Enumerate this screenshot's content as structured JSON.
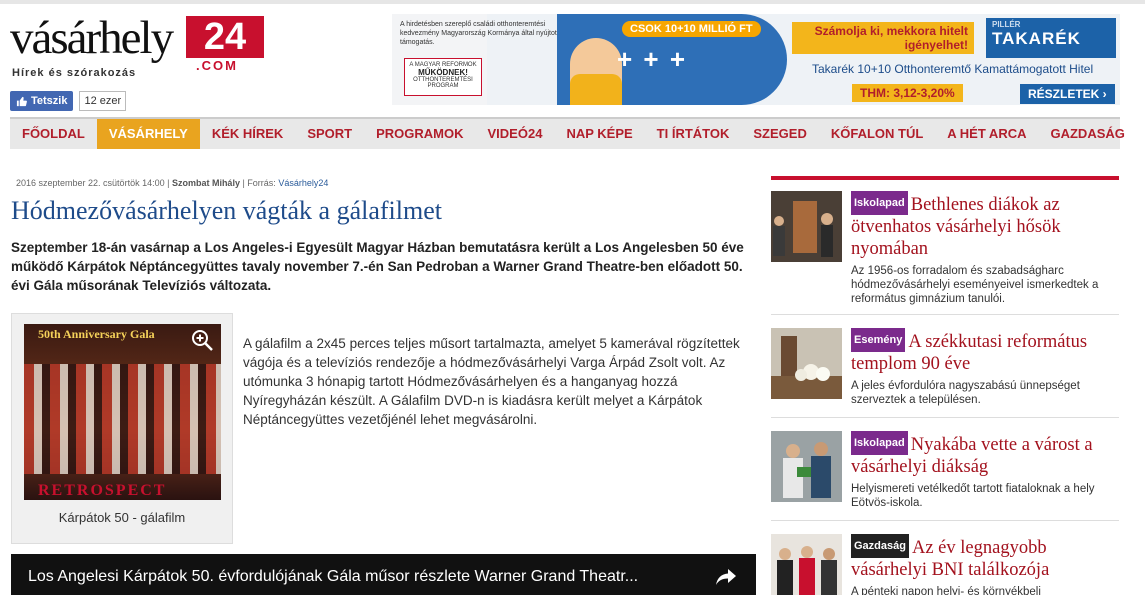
{
  "site": {
    "logo_word": "vásárhely",
    "logo_number": "24",
    "logo_com": ".COM",
    "tagline": "Hírek és szórakozás"
  },
  "facebook": {
    "like_label": "Tetszik",
    "count": "12 ezer"
  },
  "ad": {
    "disclaimer": "A hirdetésben szereplő családi otthonteremtési kedvezmény Magyarország Kormánya által nyújtott támogatás.",
    "reform_top": "A MAGYAR REFORMOK",
    "reform_main": "MŰKÖDNEK!",
    "reform_sub": "OTTHONTEREMTÉSI PROGRAM",
    "csok": "CSOK 10+10 MILLIÓ FT",
    "family": "+ + +",
    "szamolja": "Számolja ki, mekkora hitelt igényelhet!",
    "piller": "PILLÉR",
    "takarek": "TAKARÉK",
    "hitel": "Takarék 10+10 Otthonteremtő Kamattámogatott Hitel",
    "thm": "THM: 3,12-3,20%",
    "reszletek": "RÉSZLETEK"
  },
  "nav": {
    "items": [
      {
        "label": "FŐOLDAL",
        "active": false
      },
      {
        "label": "VÁSÁRHELY",
        "active": true
      },
      {
        "label": "KÉK HÍREK",
        "active": false
      },
      {
        "label": "SPORT",
        "active": false
      },
      {
        "label": "PROGRAMOK",
        "active": false
      },
      {
        "label": "VIDEÓ24",
        "active": false
      },
      {
        "label": "NAP KÉPE",
        "active": false
      },
      {
        "label": "TI ÍRTÁTOK",
        "active": false
      },
      {
        "label": "SZEGED",
        "active": false
      },
      {
        "label": "KŐFALON TÚL",
        "active": false
      },
      {
        "label": "A HÉT ARCA",
        "active": false
      },
      {
        "label": "GAZDASÁG",
        "active": false
      }
    ]
  },
  "article": {
    "date": "2016 szeptember 22. csütörtök 14:00",
    "author": "Szombat Mihály",
    "source_label": "Forrás:",
    "source": "Vásárhely24",
    "title": "Hódmezővásárhelyen vágták a gálafilmet",
    "lead": "Szeptember 18-án vasárnap a Los Angeles-i Egyesült Magyar Házban bemutatásra került a Los Angelesben 50 éve működő Kárpátok Néptáncegyüttes tavaly november 7.-én San Pedroban a Warner Grand Theatre-ben előadott 50. évi Gála műsorának Televíziós változata.",
    "photo_title": "50th Anniversary Gala",
    "photo_banner": "RETROSPECT",
    "caption": "Kárpátok 50 - gálafilm",
    "body": "A gálafilm a 2x45 perces teljes műsort tartalmazta, amelyet 5 kamerával rögzítettek vágója és a televíziós rendezője a hódmezővásárhelyi Varga Árpád Zsolt volt. Az utómunka 3 hónapig tartott Hódmezővásárhelyen és a hanganyag hozzá Nyíregyházán készült. A Gálafilm DVD-n is kiadásra került melyet a Kárpátok Néptáncegyüttes vezetőjénél lehet megvásárolni.",
    "video_title": "Los Angelesi Kárpátok 50. évfordulójának Gála műsor részlete Warner Grand Theatr..."
  },
  "sidebar": {
    "items": [
      {
        "badge": "Iskolapad",
        "badge_color": "#7b2a8c",
        "title": "Bethlenes diákok az ötvenhatos vásárhelyi hősök nyomában",
        "desc": "Az 1956-os forradalom és szabadságharc hódmezővásárhelyi eseményeivel ismerkedtek a református gimnázium tanulói."
      },
      {
        "badge": "Esemény",
        "badge_color": "#7b2a8c",
        "title": "A székkutasi református templom 90 éve",
        "desc": "A jeles évfordulóra nagyszabású ünnepséget szerveztek a településen."
      },
      {
        "badge": "Iskolapad",
        "badge_color": "#7b2a8c",
        "title": "Nyakába vette a várost a vásárhelyi diákság",
        "desc": "Helyismereti vetélkedőt tartott fiataloknak a hely Eötvös-iskola."
      },
      {
        "badge": "Gazdaság",
        "badge_color": "#222222",
        "title": "Az év legnagyobb vásárhelyi BNI találkozója",
        "desc": "A pénteki napon helyi- és környékbeli"
      }
    ]
  }
}
